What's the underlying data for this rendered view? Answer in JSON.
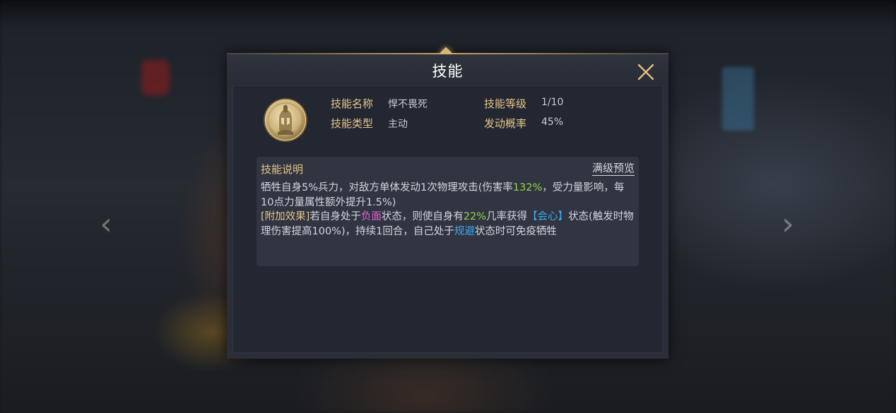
{
  "dialog": {
    "title": "技能",
    "colors": {
      "label_gold": "#e7c489",
      "highlight_green": "#9bd34a",
      "highlight_pink": "#e860d8",
      "highlight_blue": "#3fa9ec"
    },
    "skill_info": {
      "name_label": "技能名称",
      "name_value": "悍不畏死",
      "type_label": "技能类型",
      "type_value": "主动",
      "level_label": "技能等级",
      "level_value": "1/10",
      "chance_label": "发动概率",
      "chance_value": "45%"
    },
    "description": {
      "title": "技能说明",
      "preview_link": "满级预览",
      "line1_part1": "牺牲自身5%兵力，对敌方单体发动1次物理攻击(伤害率",
      "line1_rate": "132%",
      "line1_part2": "，受力量影响，每10点力量属性额外提升1.5%)",
      "bonus_tag": "[附加效果]",
      "bonus_part1": "若自身处于",
      "bonus_negative": "负面",
      "bonus_part2": "状态，则使自身有",
      "bonus_chance": "22%",
      "bonus_part3": "几率获得",
      "bonus_crit": "【会心】",
      "bonus_part4": "状态(触发时物理伤害提高100%)，持续1回合，自己处于",
      "bonus_evade": "规避",
      "bonus_part5": "状态时可免疫牺牲"
    },
    "icons": {
      "close": "close-icon",
      "skill": "spartan-helmet-icon"
    }
  }
}
